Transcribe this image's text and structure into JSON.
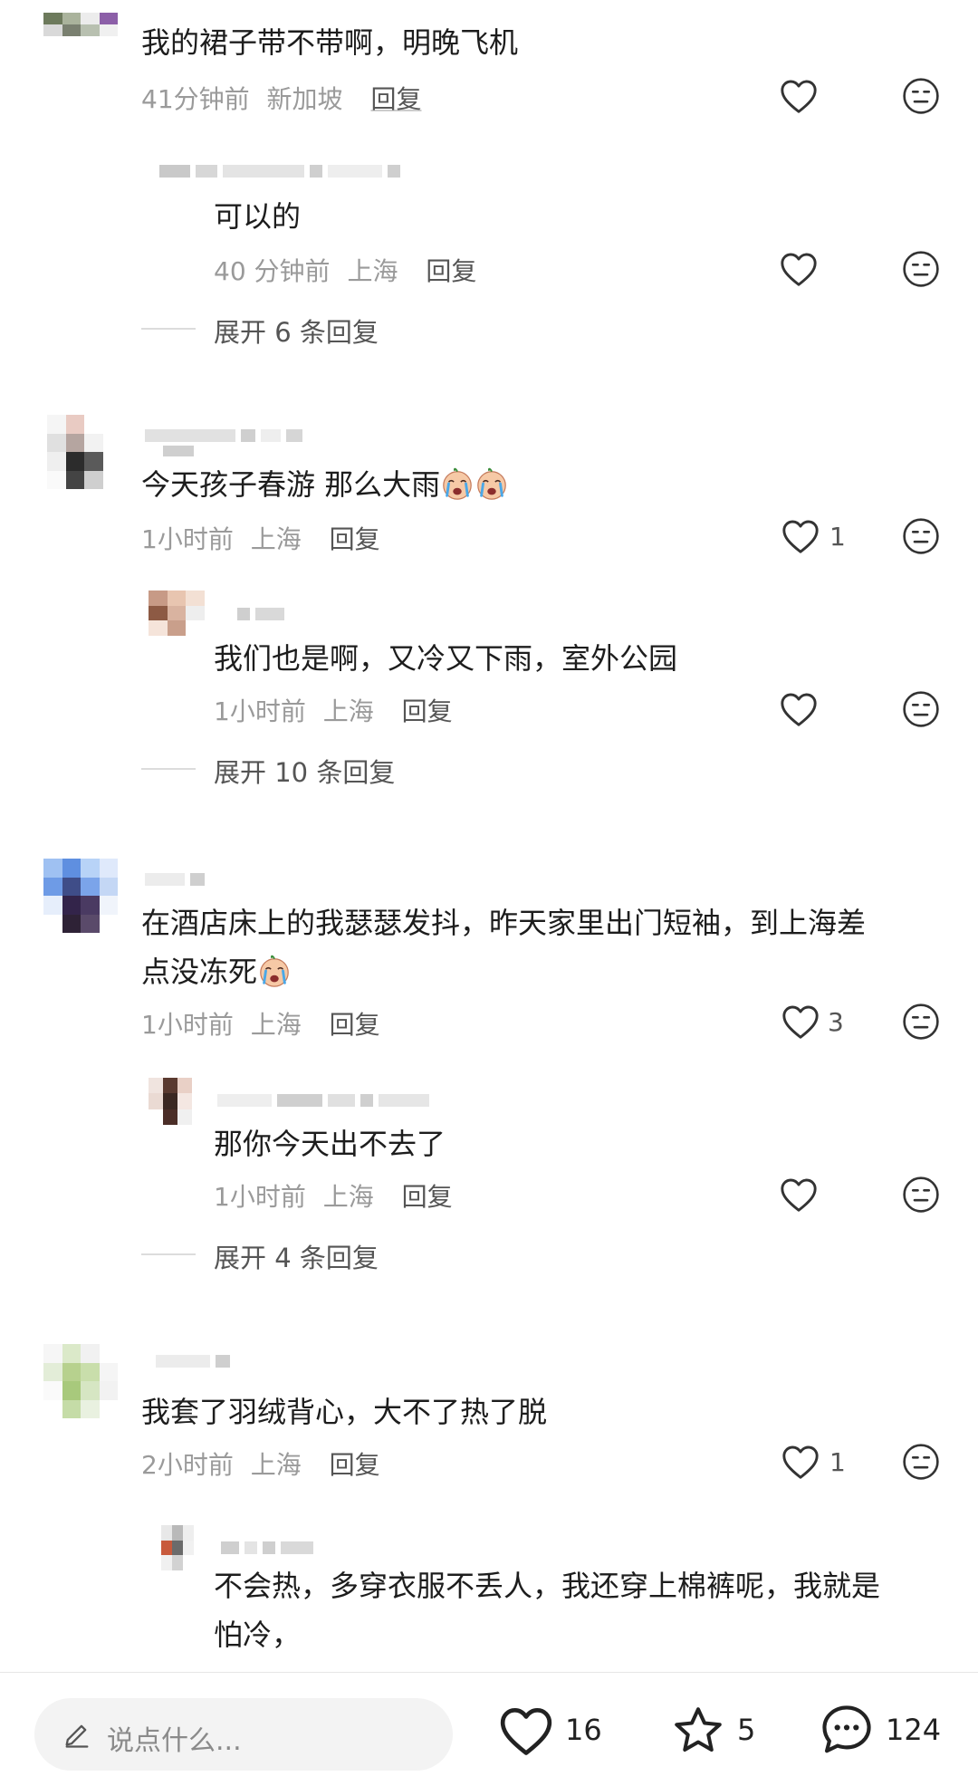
{
  "comments": [
    {
      "text": "我的裙子带不带啊，明晚飞机",
      "time": "41分钟前",
      "location": "新加坡",
      "reply_label": "回复",
      "likes": "",
      "reply": {
        "text": "可以的",
        "time": "40 分钟前",
        "location": "上海",
        "reply_label": "回复",
        "likes": ""
      },
      "expand_label": "展开 6 条回复"
    },
    {
      "text": "今天孩子春游 那么大雨",
      "time": "1小时前",
      "location": "上海",
      "reply_label": "回复",
      "likes": "1",
      "reply": {
        "text": "我们也是啊，又冷又下雨，室外公园",
        "time": "1小时前",
        "location": "上海",
        "reply_label": "回复",
        "likes": ""
      },
      "expand_label": "展开 10 条回复"
    },
    {
      "text_line1": "在酒店床上的我瑟瑟发抖，昨天家里出门短袖，到上海差",
      "text_line2": "点没冻死",
      "time": "1小时前",
      "location": "上海",
      "reply_label": "回复",
      "likes": "3",
      "reply": {
        "text": "那你今天出不去了",
        "time": "1小时前",
        "location": "上海",
        "reply_label": "回复",
        "likes": ""
      },
      "expand_label": "展开 4 条回复"
    },
    {
      "text": "我套了羽绒背心，大不了热了脱",
      "time": "2小时前",
      "location": "上海",
      "reply_label": "回复",
      "likes": "1",
      "reply": {
        "text_line1": "不会热，多穿衣服不丢人，我还穿上棉裤呢，我就是",
        "text_line2": "怕冷，"
      }
    }
  ],
  "bottom_bar": {
    "placeholder": "说点什么...",
    "likes": "16",
    "favorites": "5",
    "comments": "124"
  },
  "icons": {
    "like": "heart-outline-icon",
    "dislike": "neutral-face-icon",
    "emoji": "crying-face-emoji",
    "edit": "pencil-icon",
    "favorite": "star-outline-icon",
    "comment": "chat-bubble-icon"
  },
  "colors": {
    "text": "#1d1d1d",
    "meta": "#9a9a9a",
    "action": "#555555",
    "icon_stroke": "#333333"
  }
}
